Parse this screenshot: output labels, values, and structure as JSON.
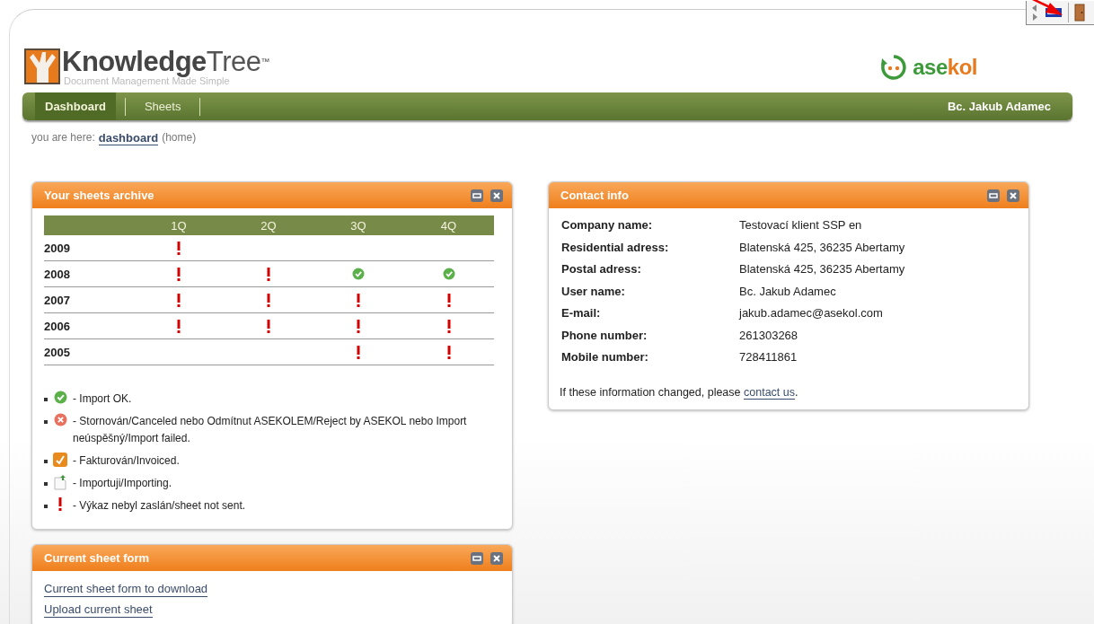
{
  "logo": {
    "name_bold": "Knowledge",
    "name_light": "Tree",
    "trademark": "™",
    "tagline": "Document Management Made Simple"
  },
  "brand": {
    "start": "ase",
    "end": "kol"
  },
  "nav": {
    "tabs": [
      {
        "label": "Dashboard",
        "selected": true
      },
      {
        "label": "Sheets",
        "selected": false
      }
    ],
    "user": "Bc. Jakub Adamec"
  },
  "breadcrumb": {
    "prefix": "you are here:",
    "link": "dashboard",
    "suffix": "(home)"
  },
  "archive": {
    "title": "Your sheets archive",
    "columns": [
      "1Q",
      "2Q",
      "3Q",
      "4Q"
    ],
    "rows": [
      {
        "year": "2009",
        "cells": [
          {
            "kind": "not_sent"
          },
          {
            "kind": "empty"
          },
          {
            "kind": "empty"
          },
          {
            "kind": "empty"
          }
        ]
      },
      {
        "year": "2008",
        "cells": [
          {
            "kind": "not_sent"
          },
          {
            "kind": "not_sent"
          },
          {
            "kind": "ok"
          },
          {
            "kind": "ok"
          }
        ]
      },
      {
        "year": "2007",
        "cells": [
          {
            "kind": "not_sent"
          },
          {
            "kind": "not_sent"
          },
          {
            "kind": "not_sent"
          },
          {
            "kind": "not_sent"
          }
        ]
      },
      {
        "year": "2006",
        "cells": [
          {
            "kind": "not_sent"
          },
          {
            "kind": "not_sent"
          },
          {
            "kind": "not_sent"
          },
          {
            "kind": "not_sent"
          }
        ]
      },
      {
        "year": "2005",
        "cells": [
          {
            "kind": "empty"
          },
          {
            "kind": "empty"
          },
          {
            "kind": "not_sent"
          },
          {
            "kind": "not_sent"
          }
        ]
      }
    ],
    "legend": [
      {
        "kind": "ok",
        "text": "- Import OK."
      },
      {
        "kind": "rejected",
        "text": "- Stornován/Canceled nebo Odmítnut ASEKOLEM/Reject by ASEKOL nebo Import neúspěšný/Import failed."
      },
      {
        "kind": "invoiced",
        "text": "- Fakturován/Invoiced."
      },
      {
        "kind": "importing",
        "text": "- Importuji/Importing."
      },
      {
        "kind": "not_sent",
        "text": "- Výkaz nebyl zaslán/sheet not sent."
      }
    ]
  },
  "contact": {
    "title": "Contact info",
    "fields": [
      {
        "label": "Company name:",
        "value": "Testovací klient SSP en"
      },
      {
        "label": "Residential adress:",
        "value": "Blatenská 425, 36235 Abertamy"
      },
      {
        "label": "Postal adress:",
        "value": "Blatenská 425, 36235 Abertamy"
      },
      {
        "label": "User name:",
        "value": "Bc. Jakub Adamec"
      },
      {
        "label": "E-mail:",
        "value": "jakub.adamec@asekol.com"
      },
      {
        "label": "Phone number:",
        "value": "261303268"
      },
      {
        "label": "Mobile number:",
        "value": "728411861"
      }
    ],
    "note": "If these information changed, please",
    "note_link": "contact us",
    "note_end": "."
  },
  "sheet_form": {
    "title": "Current sheet form",
    "links": [
      "Current sheet form to download",
      "Upload current sheet"
    ]
  }
}
